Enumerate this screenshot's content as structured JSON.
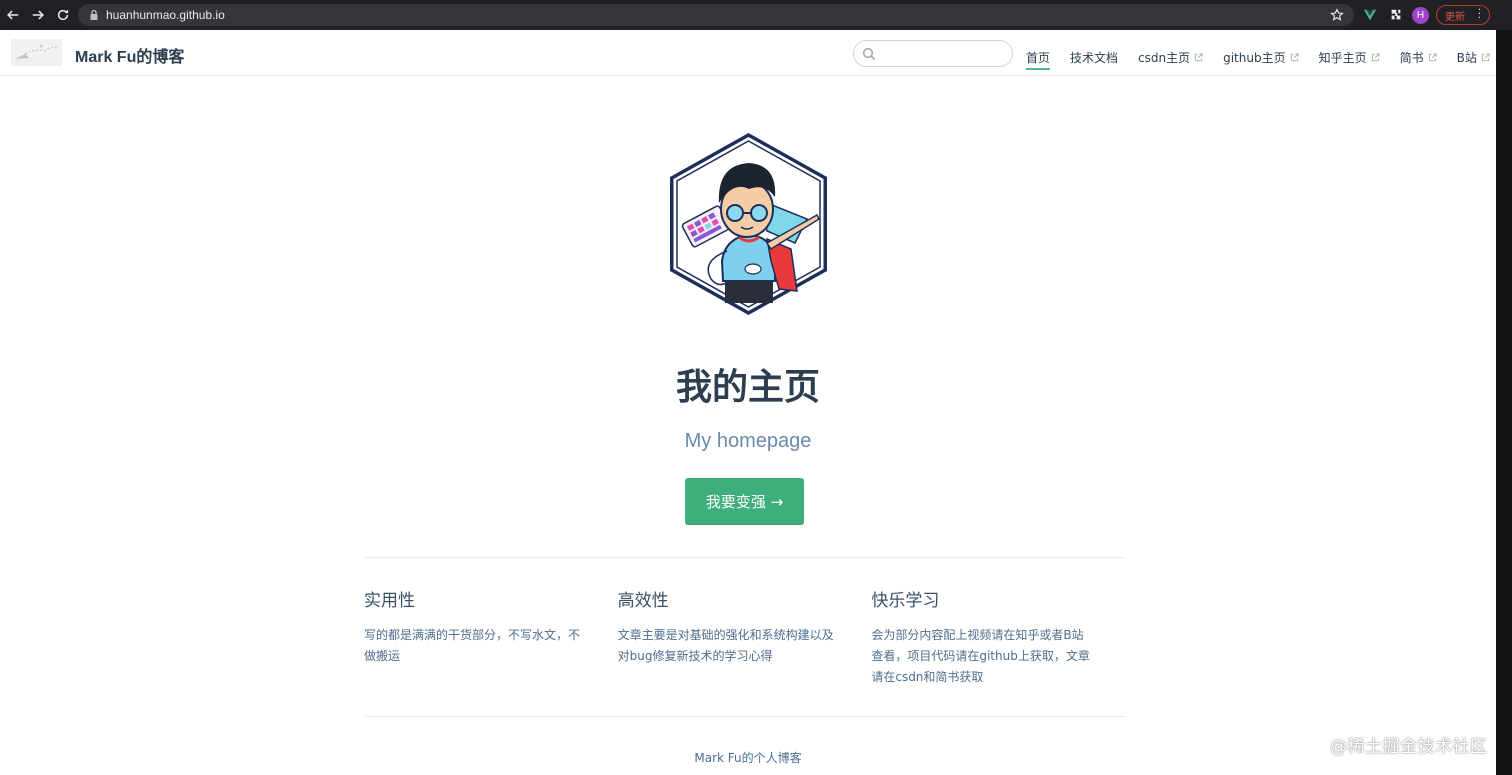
{
  "browser": {
    "url": "huanhunmao.github.io",
    "avatar_letter": "H",
    "update_label": "更新"
  },
  "navbar": {
    "site_name": "Mark Fu的博客",
    "search_placeholder": "",
    "links": [
      {
        "label": "首页",
        "active": true,
        "external": false
      },
      {
        "label": "技术文档",
        "external": false
      },
      {
        "label": "csdn主页",
        "external": true
      },
      {
        "label": "github主页",
        "external": true
      },
      {
        "label": "知乎主页",
        "external": true
      },
      {
        "label": "简书",
        "external": true
      },
      {
        "label": "B站",
        "external": true
      }
    ]
  },
  "hero": {
    "title": "我的主页",
    "description": "My homepage",
    "action_label": "我要变强 →"
  },
  "features": [
    {
      "title": "实用性",
      "details": "写的都是满满的干货部分，不写水文，不做搬运"
    },
    {
      "title": "高效性",
      "details": "文章主要是对基础的强化和系统构建以及对bug修复新技术的学习心得"
    },
    {
      "title": "快乐学习",
      "details": "会为部分内容配上视频请在知乎或者B站查看，项目代码请在github上获取，文章请在csdn和简书获取"
    }
  ],
  "footer": {
    "text": "Mark Fu的个人博客"
  },
  "watermark": {
    "text": "@稀土掘金技术社区"
  },
  "colors": {
    "accent": "#3eaf7c",
    "text": "#2c3e50",
    "muted": "#6a8bad"
  }
}
